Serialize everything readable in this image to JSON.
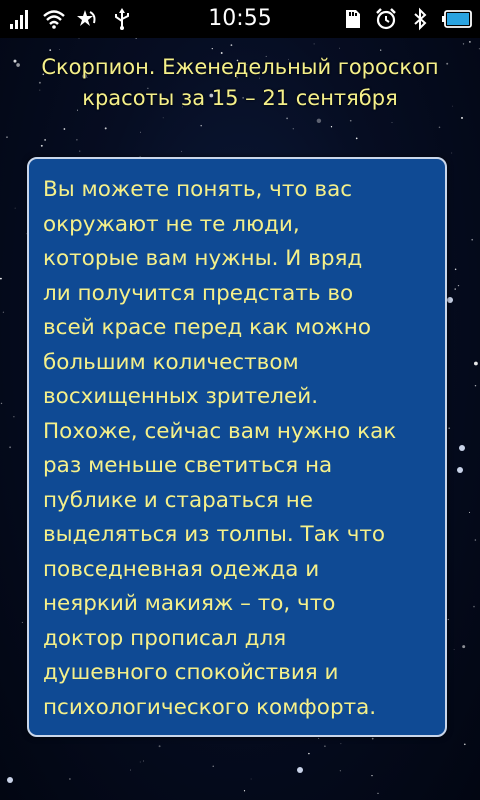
{
  "status_bar": {
    "time": "10:55"
  },
  "title": "Скорпион. Еженедельный гороскоп\nкрасоты за 15 – 21 сентября",
  "body": "Вы можете понять, что вас\nокружают не те люди,\nкоторые вам нужны. И вряд\nли получится предстать во\nвсей красе перед как можно\nбольшим количеством\nвосхищенных зрителей.\nПохоже, сейчас вам нужно как\nраз меньше светиться на\nпублике и стараться не\nвыделяться из толпы. Так что\nповседневная одежда и\nнеяркий макияж – то, что\nдоктор прописал для\nдушевного спокойствия и\nпсихологического комфорта.",
  "colors": {
    "text": "#f5f08a",
    "card_background": "#0f4a94",
    "card_border": "#c9d6ea",
    "battery": "#2aa3e0"
  },
  "icons": [
    "signal-icon",
    "wifi-icon",
    "starred-icon",
    "usb-icon",
    "sd-card-icon",
    "alarm-icon",
    "bluetooth-icon",
    "battery-icon"
  ]
}
